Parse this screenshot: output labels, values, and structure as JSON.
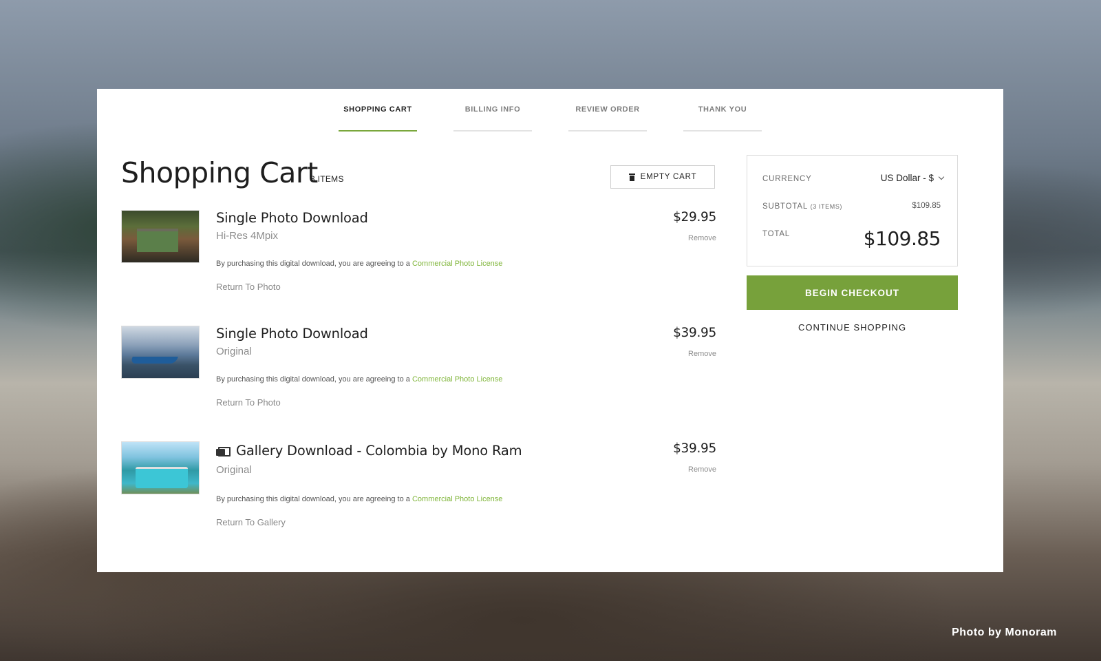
{
  "steps": [
    "SHOPPING CART",
    "BILLING INFO",
    "REVIEW ORDER",
    "THANK YOU"
  ],
  "cart": {
    "title": "Shopping Cart",
    "item_count": "3 ITEMS",
    "empty_button": "EMPTY CART",
    "license_text": "By purchasing this digital download, you are agreeing to a ",
    "license_link": "Commercial Photo License",
    "remove_label": "Remove",
    "items": [
      {
        "title": "Single Photo Download",
        "variant": "Hi-Res 4Mpix",
        "price": "$29.95",
        "return_link": "Return To Photo"
      },
      {
        "title": "Single Photo Download",
        "variant": "Original",
        "price": "$39.95",
        "return_link": "Return To Photo"
      },
      {
        "title": "Gallery Download - Colombia by Mono Ram",
        "variant": "Original",
        "price": "$39.95",
        "return_link": "Return To Gallery",
        "icon": "gallery-icon"
      }
    ]
  },
  "summary": {
    "currency_label": "CURRENCY",
    "currency_value": "US Dollar - $",
    "subtotal_label": "SUBTOTAL",
    "subtotal_items": "(3 ITEMS)",
    "subtotal_value": "$109.85",
    "total_label": "TOTAL",
    "total_value": "$109.85",
    "checkout_button": "BEGIN CHECKOUT",
    "continue_link": "CONTINUE SHOPPING"
  },
  "photo_credit": "Photo by Monoram",
  "colors": {
    "accent": "#77a13b",
    "link": "#7fb539"
  }
}
